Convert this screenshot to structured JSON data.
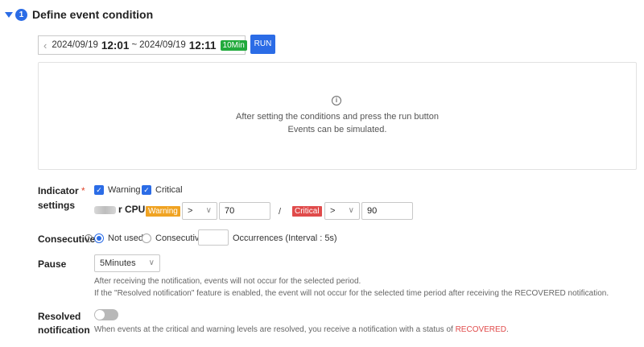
{
  "section": {
    "step_number": "1",
    "title": "Define event condition"
  },
  "time_range": {
    "start_date": "2024/09/19",
    "start_time": "12:01",
    "separator": "~",
    "end_date": "2024/09/19",
    "end_time": "12:11",
    "duration_badge": "10Min",
    "prev_icon": "chevron-left-icon",
    "next_icon": "chevron-right-icon"
  },
  "run_button": {
    "label": "RUN"
  },
  "simulation": {
    "icon": "info-icon",
    "line1": "After setting the conditions and press the run button",
    "line2": "Events can be simulated."
  },
  "indicator": {
    "label_line1": "Indicator",
    "required_mark": "*",
    "label_line2": "settings",
    "checkboxes": [
      {
        "label": "Warning",
        "checked": true
      },
      {
        "label": "Critical",
        "checked": true
      }
    ],
    "metric_suffix": "r CPU",
    "warning": {
      "badge": "Warning",
      "operator": ">",
      "value": "70"
    },
    "divider": "/",
    "critical": {
      "badge": "Critical",
      "operator": ">",
      "value": "90"
    }
  },
  "consecutive": {
    "label": "Consecutive",
    "options": [
      {
        "label": "Not used",
        "selected": true
      },
      {
        "label": "Consecutive",
        "selected": false
      }
    ],
    "occurrences_value": "",
    "occurrences_label": "Occurrences (Interval : 5s)"
  },
  "pause": {
    "label": "Pause",
    "selected": "5Minutes",
    "help1": "After receiving the notification, events will not occur for the selected period.",
    "help2": "If the \"Resolved notification\" feature is enabled, the event will not occur for the selected time period after receiving the RECOVERED notification."
  },
  "resolved": {
    "label_line1": "Resolved",
    "label_line2": "notification",
    "enabled": false,
    "help_prefix": "When events at the critical and warning levels are resolved, you receive a notification with a status of ",
    "help_status": "RECOVERED",
    "help_suffix": "."
  },
  "colors": {
    "primary": "#2b6ce6",
    "success": "#22aa3c",
    "warning": "#f0a322",
    "critical": "#e04b4b"
  }
}
